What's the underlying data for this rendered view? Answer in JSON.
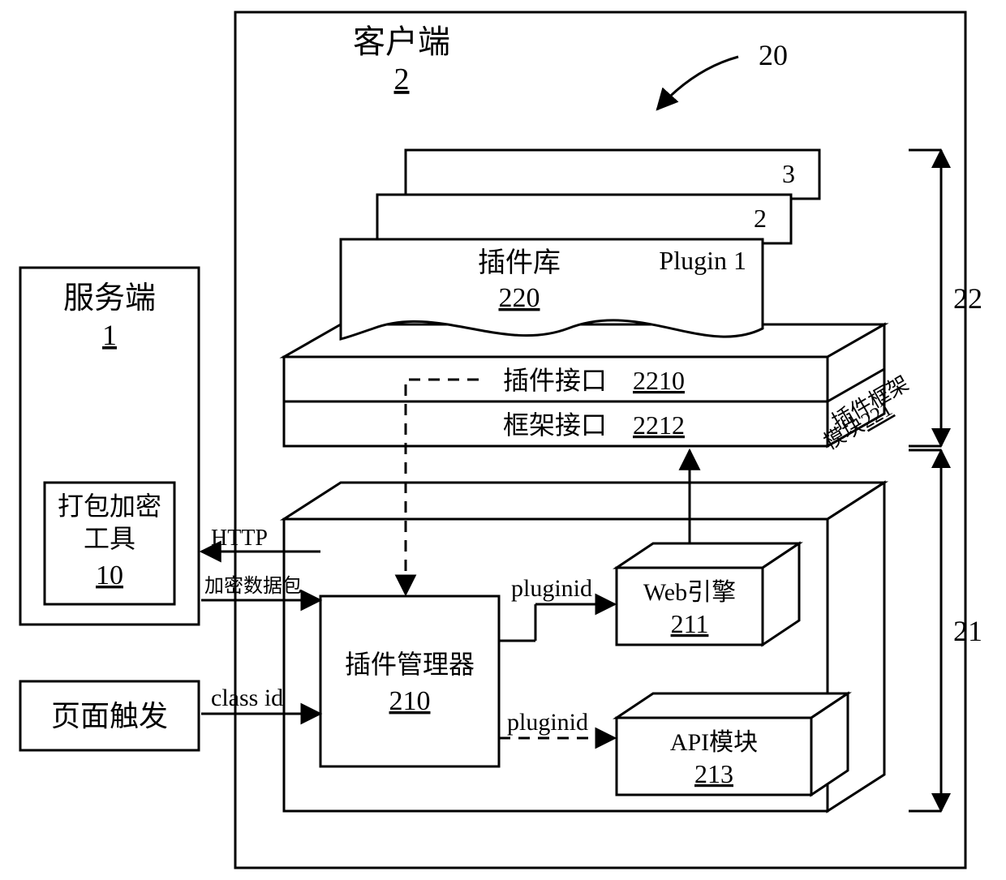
{
  "client": {
    "title": "客户端",
    "id": "2",
    "system_ref": "20"
  },
  "server": {
    "title": "服务端",
    "id": "1",
    "tool_line1": "打包加密",
    "tool_line2": "工具",
    "tool_id": "10"
  },
  "page_trigger": {
    "label": "页面触发"
  },
  "plugin_stack": {
    "card3": "3",
    "card2": "2",
    "card1_right": "Plugin 1",
    "lib_title": "插件库",
    "lib_id": "220",
    "interface_top_label": "插件接口",
    "interface_top_id": "2210",
    "interface_bottom_label": "框架接口",
    "interface_bottom_id": "2212",
    "side_label_l1": "插件框架",
    "side_label_l2": "模块",
    "side_label_id": "221"
  },
  "lower_block": {
    "plugin_mgr_title": "插件管理器",
    "plugin_mgr_id": "210",
    "web_engine_title": "Web引擎",
    "web_engine_id": "211",
    "api_title": "API模块",
    "api_id": "213"
  },
  "labels": {
    "http": "HTTP",
    "enc_pkt": "加密数据包",
    "classid": "class id",
    "pluginid_top": "pluginid",
    "pluginid_bottom": "pluginid"
  },
  "brackets": {
    "upper": "22",
    "lower": "21"
  }
}
